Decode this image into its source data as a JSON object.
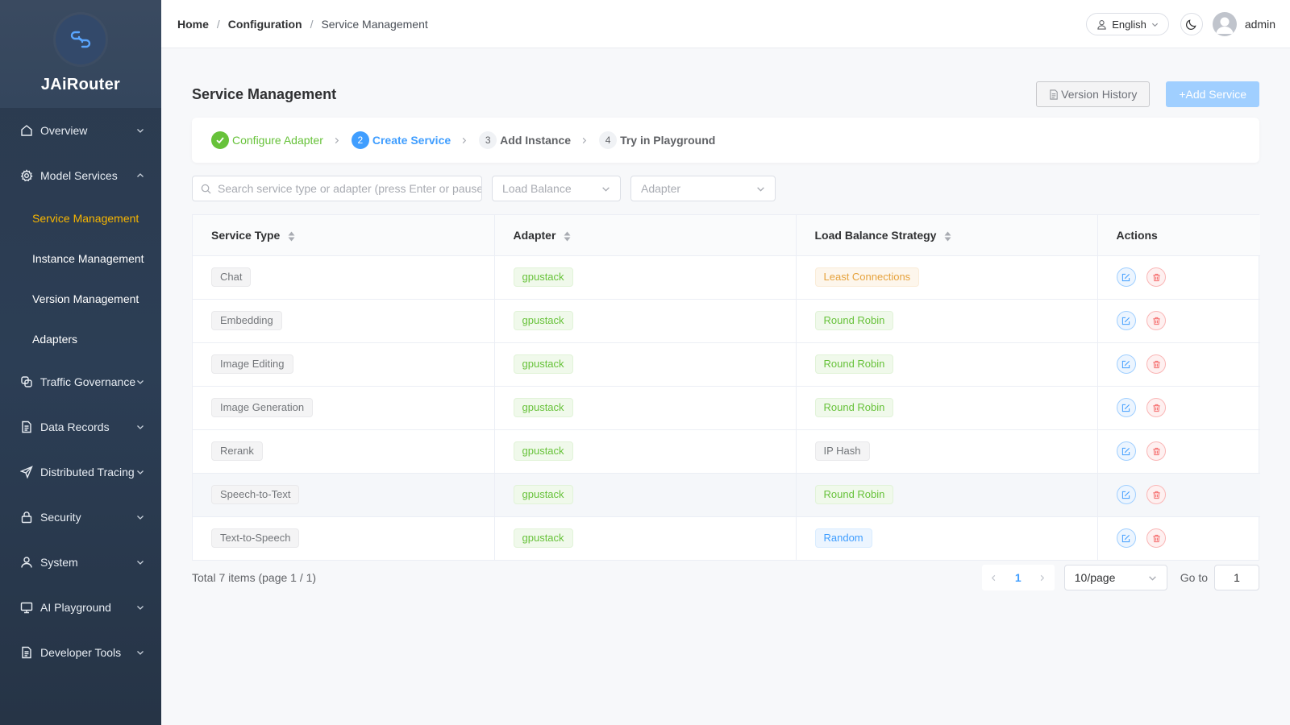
{
  "app": {
    "name": "JAiRouter"
  },
  "sidebar": {
    "items": [
      {
        "label": "Overview",
        "icon": "home-icon",
        "expanded": false
      },
      {
        "label": "Model Services",
        "icon": "gear-icon",
        "expanded": true,
        "children": [
          {
            "label": "Service Management",
            "active": true
          },
          {
            "label": "Instance Management"
          },
          {
            "label": "Version Management"
          },
          {
            "label": "Adapters"
          }
        ]
      },
      {
        "label": "Traffic Governance",
        "icon": "traffic-icon",
        "expanded": false
      },
      {
        "label": "Data Records",
        "icon": "document-icon",
        "expanded": false
      },
      {
        "label": "Distributed Tracing",
        "icon": "send-icon",
        "expanded": false
      },
      {
        "label": "Security",
        "icon": "lock-icon",
        "expanded": false
      },
      {
        "label": "System",
        "icon": "user-icon",
        "expanded": false
      },
      {
        "label": "AI Playground",
        "icon": "monitor-icon",
        "expanded": false
      },
      {
        "label": "Developer Tools",
        "icon": "document-icon",
        "expanded": false
      }
    ]
  },
  "header": {
    "breadcrumb": [
      "Home",
      "Configuration",
      "Service Management"
    ],
    "language": "English",
    "user": "admin"
  },
  "page": {
    "title": "Service Management",
    "version_history_label": "Version History",
    "add_service_label": "+Add Service"
  },
  "steps": [
    {
      "num": "✓",
      "label": "Configure Adapter",
      "status": "done"
    },
    {
      "num": "2",
      "label": "Create Service",
      "status": "current"
    },
    {
      "num": "3",
      "label": "Add Instance",
      "status": "pending"
    },
    {
      "num": "4",
      "label": "Try in Playground",
      "status": "pending"
    }
  ],
  "filters": {
    "search_placeholder": "Search service type or adapter (press Enter or pause)",
    "load_balance_placeholder": "Load Balance",
    "adapter_placeholder": "Adapter"
  },
  "table": {
    "columns": [
      "Service Type",
      "Adapter",
      "Load Balance Strategy",
      "Actions"
    ],
    "rows": [
      {
        "service_type": "Chat",
        "adapter": "gpustack",
        "strategy": "Least Connections",
        "strategy_style": "warning"
      },
      {
        "service_type": "Embedding",
        "adapter": "gpustack",
        "strategy": "Round Robin",
        "strategy_style": "success"
      },
      {
        "service_type": "Image Editing",
        "adapter": "gpustack",
        "strategy": "Round Robin",
        "strategy_style": "success"
      },
      {
        "service_type": "Image Generation",
        "adapter": "gpustack",
        "strategy": "Round Robin",
        "strategy_style": "success"
      },
      {
        "service_type": "Rerank",
        "adapter": "gpustack",
        "strategy": "IP Hash",
        "strategy_style": "info"
      },
      {
        "service_type": "Speech-to-Text",
        "adapter": "gpustack",
        "strategy": "Round Robin",
        "strategy_style": "success"
      },
      {
        "service_type": "Text-to-Speech",
        "adapter": "gpustack",
        "strategy": "Random",
        "strategy_style": "primary"
      }
    ]
  },
  "pagination": {
    "total_text": "Total 7 items (page 1 / 1)",
    "current_page": "1",
    "page_size": "10/page",
    "goto_label": "Go to",
    "goto_value": "1"
  },
  "colors": {
    "sidebar_bg": "#2b3a4e",
    "active_menu": "#f7b500",
    "primary": "#409eff",
    "success": "#67c23a",
    "warning": "#e6a23c",
    "danger": "#f56c6c"
  }
}
